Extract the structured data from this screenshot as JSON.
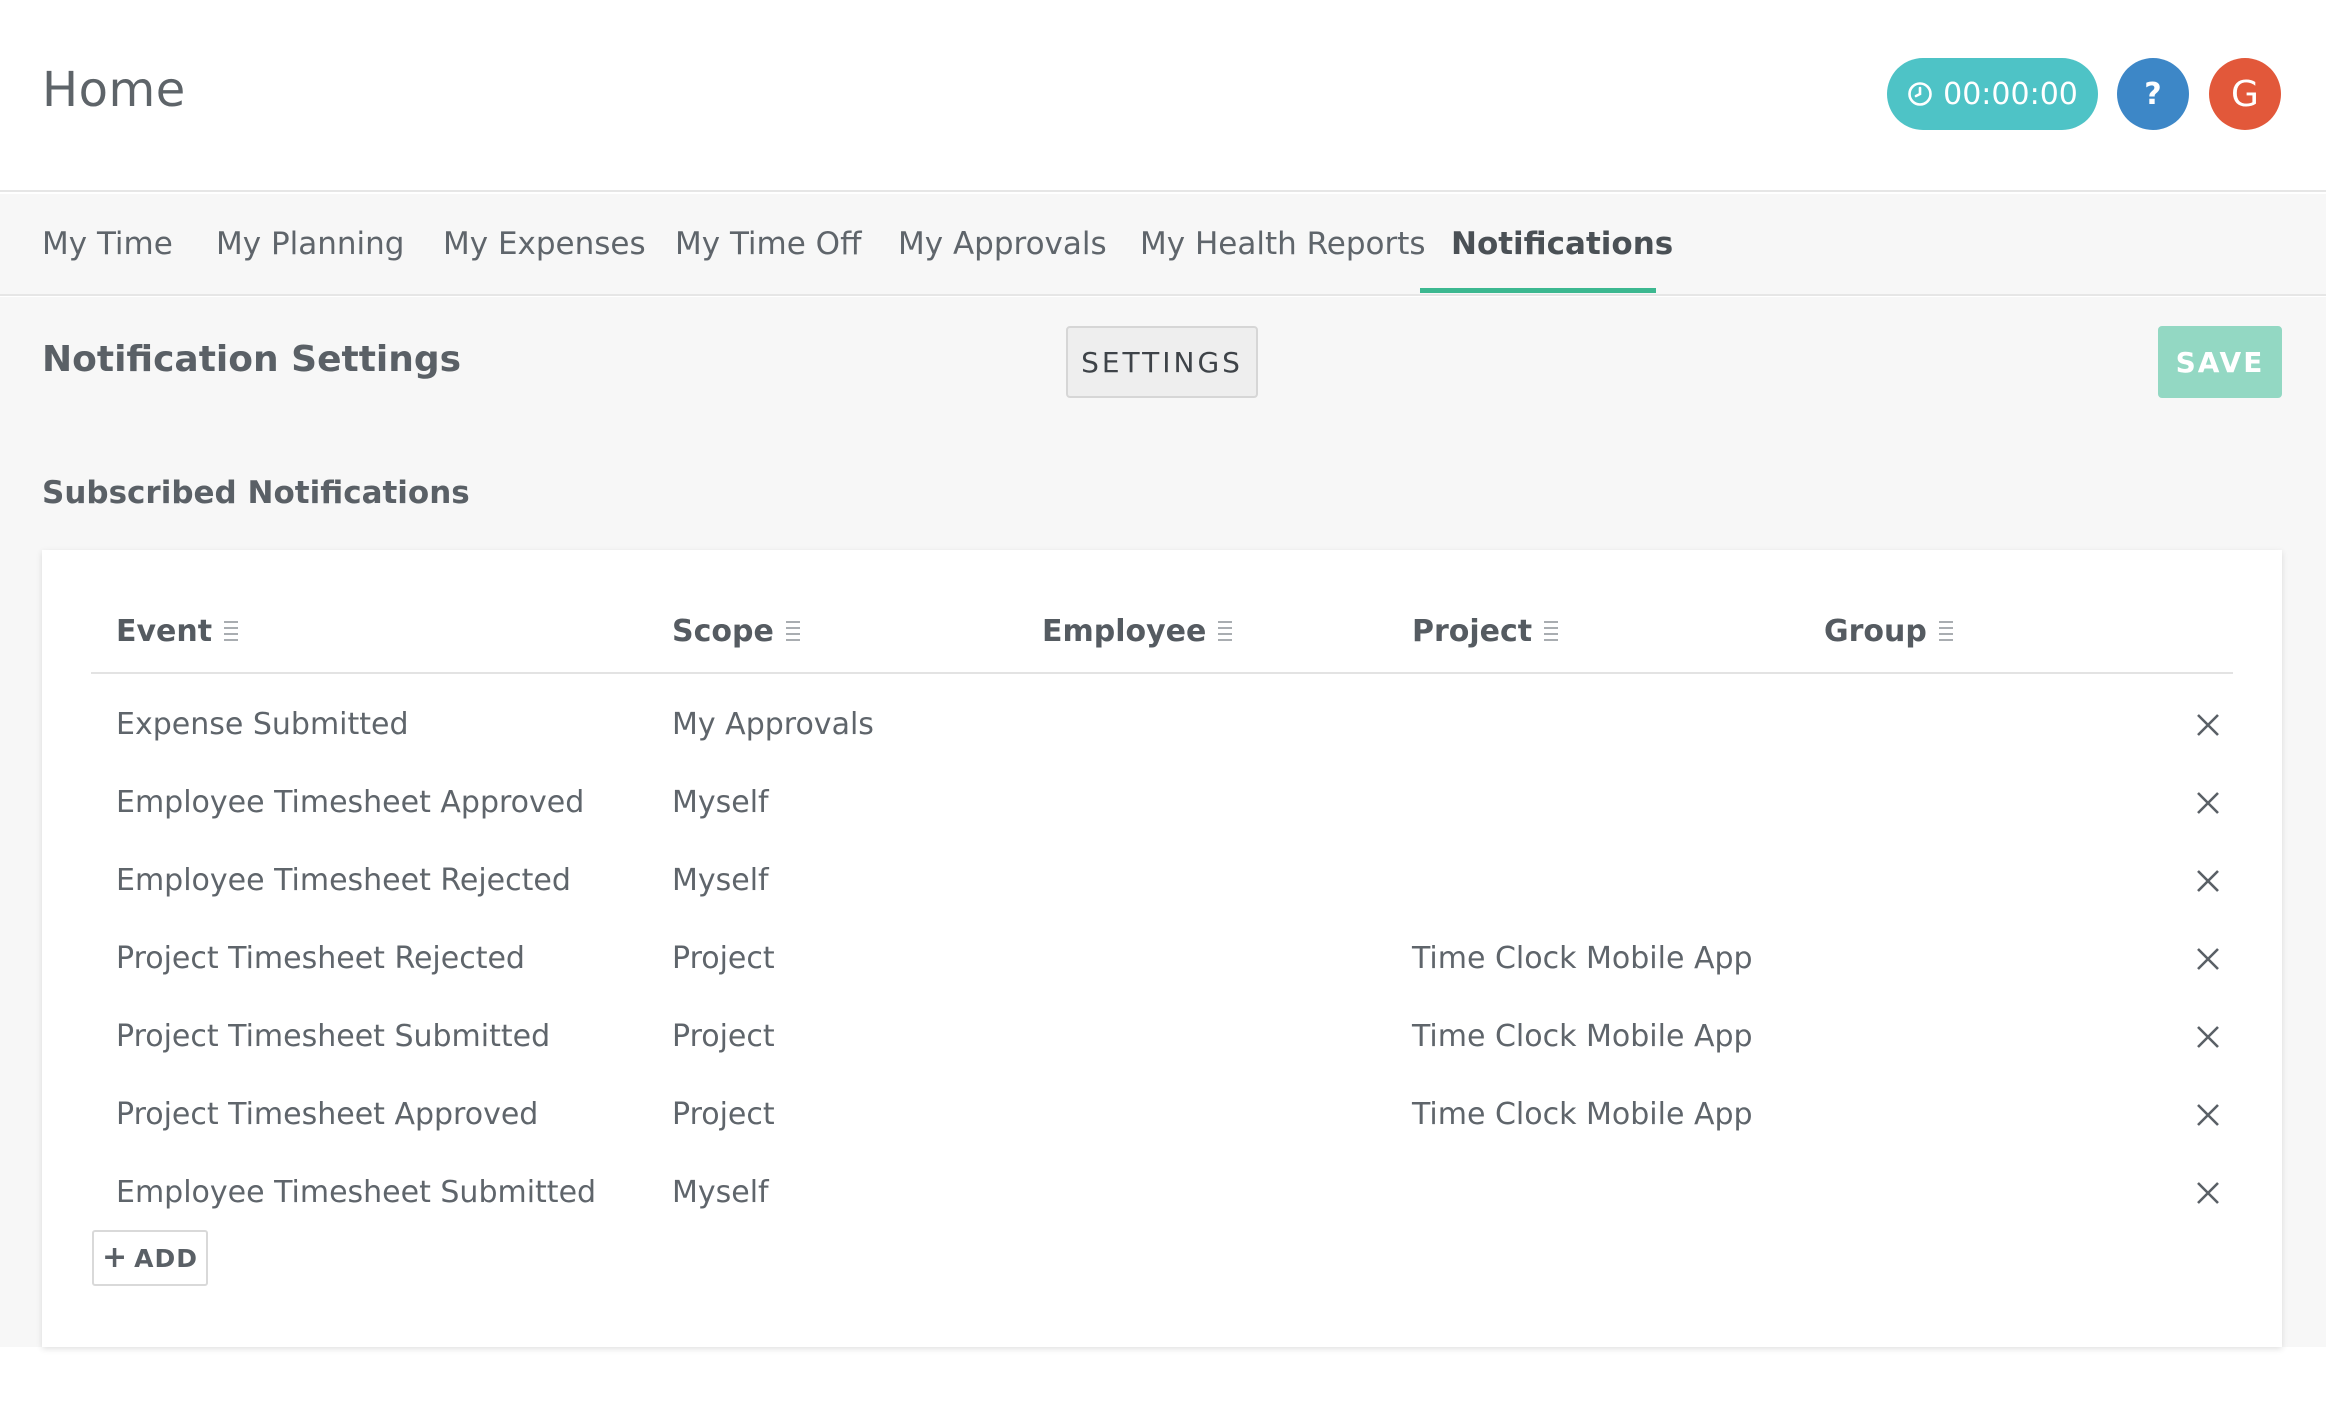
{
  "header": {
    "title": "Home",
    "timer": "00:00:00",
    "help_label": "?",
    "avatar_initial": "G"
  },
  "tabs": [
    {
      "label": "My Time"
    },
    {
      "label": "My Planning"
    },
    {
      "label": "My Expenses"
    },
    {
      "label": "My Time Off"
    },
    {
      "label": "My Approvals"
    },
    {
      "label": "My Health Reports"
    },
    {
      "label": "Notifications",
      "active": true
    }
  ],
  "main": {
    "title": "Notification Settings",
    "settings_label": "SETTINGS",
    "save_label": "SAVE",
    "subtitle": "Subscribed Notifications"
  },
  "table": {
    "columns": [
      "Event",
      "Scope",
      "Employee",
      "Project",
      "Group"
    ],
    "rows": [
      {
        "event": "Expense Submitted",
        "scope": "My Approvals",
        "employee": "",
        "project": "",
        "group": ""
      },
      {
        "event": "Employee Timesheet Approved",
        "scope": "Myself",
        "employee": "",
        "project": "",
        "group": ""
      },
      {
        "event": "Employee Timesheet Rejected",
        "scope": "Myself",
        "employee": "",
        "project": "",
        "group": ""
      },
      {
        "event": "Project Timesheet Rejected",
        "scope": "Project",
        "employee": "",
        "project": "Time Clock Mobile App",
        "group": ""
      },
      {
        "event": "Project Timesheet Submitted",
        "scope": "Project",
        "employee": "",
        "project": "Time Clock Mobile App",
        "group": ""
      },
      {
        "event": "Project Timesheet Approved",
        "scope": "Project",
        "employee": "",
        "project": "Time Clock Mobile App",
        "group": ""
      },
      {
        "event": "Employee Timesheet Submitted",
        "scope": "Myself",
        "employee": "",
        "project": "",
        "group": ""
      }
    ],
    "add_label": "ADD"
  },
  "icons": {
    "timer": "clock-icon",
    "column_menu": "column-menu-icon",
    "remove": "close-icon",
    "add": "plus-icon"
  },
  "colors": {
    "timer": "#4ec3c6",
    "help": "#3d87c7",
    "avatar": "#e2583a",
    "active_tab": "#3cb890",
    "save": "#93d8c3"
  }
}
